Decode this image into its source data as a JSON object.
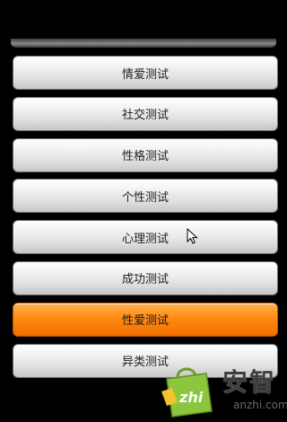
{
  "menu": {
    "items": [
      {
        "label": "情爱测试",
        "active": false
      },
      {
        "label": "社交测试",
        "active": false
      },
      {
        "label": "性格测试",
        "active": false
      },
      {
        "label": "个性测试",
        "active": false
      },
      {
        "label": "心理测试",
        "active": false
      },
      {
        "label": "成功测试",
        "active": false
      },
      {
        "label": "性爱测试",
        "active": true
      },
      {
        "label": "异类测试",
        "active": false
      }
    ]
  },
  "watermark": {
    "icon_text": "zhi",
    "brand_cn": "安智",
    "brand_en": "anzhi.com"
  },
  "colors": {
    "background": "#000000",
    "button_face": "#e6e6e6",
    "active_button": "#ff8a12",
    "watermark_green": "#8cc63f"
  },
  "icons": {
    "cursor": "mouse-pointer-icon",
    "watermark_logo": "shopping-bag-icon"
  }
}
